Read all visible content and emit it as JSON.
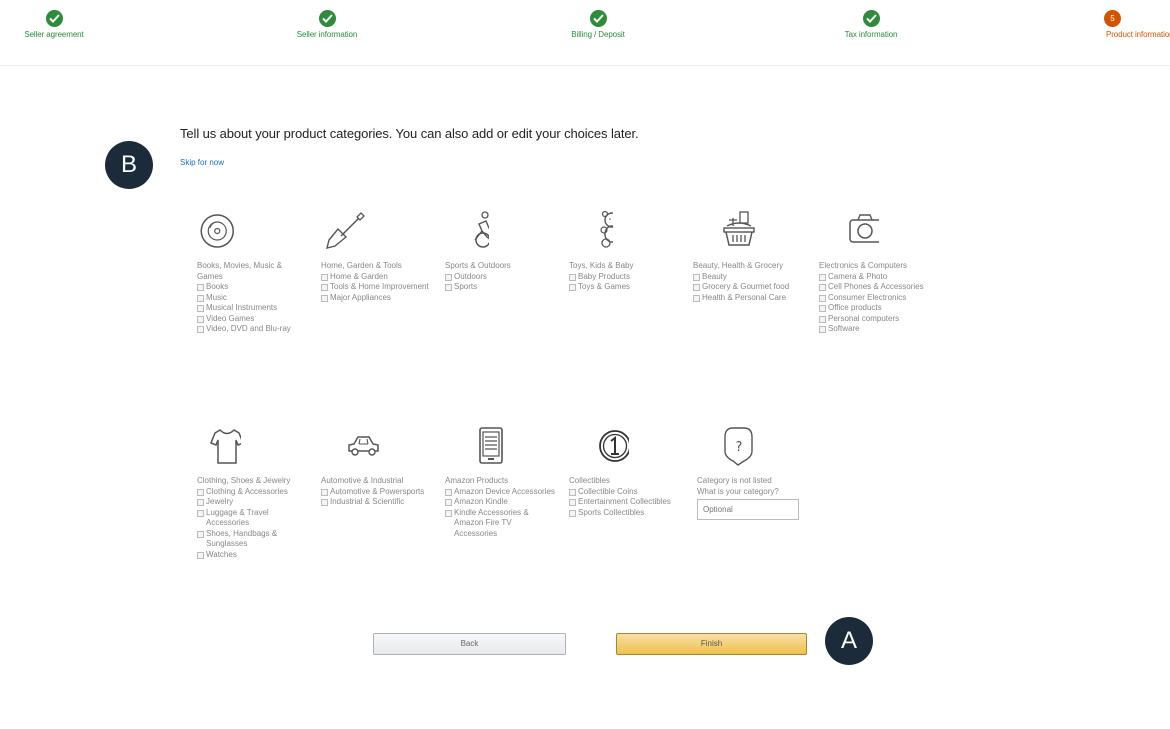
{
  "progress": {
    "steps": [
      {
        "label": "Seller agreement",
        "status": "done"
      },
      {
        "label": "Seller information",
        "status": "done"
      },
      {
        "label": "Billing / Deposit",
        "status": "done"
      },
      {
        "label": "Tax information",
        "status": "done"
      },
      {
        "label": "Product information",
        "status": "current",
        "number": "5"
      }
    ]
  },
  "heading": "Tell us about your product categories. You can also add or edit your choices later.",
  "skip_link": "Skip for now",
  "categories": [
    {
      "title": "Books, Movies, Music & Games",
      "icon": "disc-icon",
      "options": [
        "Books",
        "Music",
        "Musical Instruments",
        "Video Games",
        "Video, DVD and Blu-ray"
      ]
    },
    {
      "title": "Home, Garden & Tools",
      "icon": "shovel-icon",
      "options": [
        "Home & Garden",
        "Tools & Home Improvement",
        "Major Appliances"
      ]
    },
    {
      "title": "Sports & Outdoors",
      "icon": "cyclist-icon",
      "options": [
        "Outdoors",
        "Sports"
      ]
    },
    {
      "title": "Toys, Kids & Baby",
      "icon": "teddy-bear-icon",
      "options": [
        "Baby Products",
        "Toys & Games"
      ]
    },
    {
      "title": "Beauty, Health & Grocery",
      "icon": "grocery-basket-icon",
      "options": [
        "Beauty",
        "Grocery & Gourmet food",
        "Health & Personal Care"
      ]
    },
    {
      "title": "Electronics & Computers",
      "icon": "camera-icon",
      "options": [
        "Camera & Photo",
        "Cell Phones & Accessories",
        "Consumer Electronics",
        "Office products",
        "Personal computers",
        "Software"
      ]
    },
    {
      "title": "Clothing, Shoes & Jewelry",
      "icon": "t-shirt-icon",
      "options": [
        "Clothing & Accessories",
        "Jewelry",
        "Luggage & Travel Accessories",
        "Shoes, Handbags & Sunglasses",
        "Watches"
      ]
    },
    {
      "title": "Automotive & Industrial",
      "icon": "car-icon",
      "options": [
        "Automotive & Powersports",
        "Industrial & Scientific"
      ]
    },
    {
      "title": "Amazon Products",
      "icon": "e-reader-icon",
      "options": [
        "Amazon Device Accessories",
        "Amazon Kindle",
        "Kindle Accessories & Amazon Fire TV Accessories"
      ]
    },
    {
      "title": "Collectibles",
      "icon": "coin-icon",
      "options": [
        "Collectible Coins",
        "Entertainment Collectibles",
        "Sports Collectibles"
      ]
    }
  ],
  "other_category": {
    "title": "Category is not listed",
    "question": "What is your category?",
    "placeholder": "Optional",
    "icon": "question-bubble-icon"
  },
  "buttons": {
    "back": "Back",
    "finish": "Finish"
  },
  "annotations": {
    "a": "A",
    "b": "B"
  },
  "colors": {
    "done": "#2e8b3a",
    "current": "#d35400",
    "badge": "#1c2b3a",
    "link": "#1a6fb5",
    "finish": "#f0c14b"
  }
}
